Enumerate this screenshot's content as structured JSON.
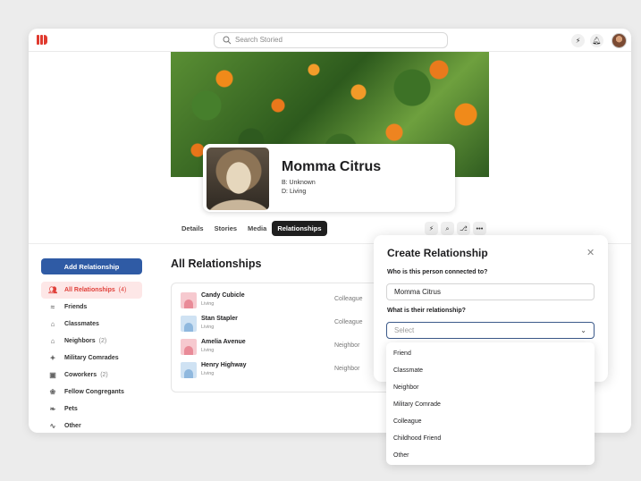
{
  "topbar": {
    "search_placeholder": "Search Storied",
    "icons": [
      "bolt-icon",
      "bell-icon"
    ]
  },
  "profile": {
    "name": "Momma Citrus",
    "birth": "B: Unknown",
    "death": "D: Living"
  },
  "tabs": [
    {
      "label": "Details"
    },
    {
      "label": "Stories"
    },
    {
      "label": "Media"
    },
    {
      "label": "Relationships",
      "active": true
    }
  ],
  "tab_tools": [
    "bolt-icon",
    "search-icon",
    "tree-icon",
    "more-icon"
  ],
  "sidebar": {
    "add_button": "Add Relationship",
    "items": [
      {
        "label": "All Relationships",
        "count": "(4)",
        "icon": "people-icon",
        "active": true
      },
      {
        "label": "Friends",
        "count": "",
        "icon": "handshake-icon"
      },
      {
        "label": "Classmates",
        "count": "",
        "icon": "school-icon"
      },
      {
        "label": "Neighbors",
        "count": "(2)",
        "icon": "house-icon"
      },
      {
        "label": "Military Comrades",
        "count": "",
        "icon": "medal-icon"
      },
      {
        "label": "Coworkers",
        "count": "(2)",
        "icon": "briefcase-icon"
      },
      {
        "label": "Fellow Congregants",
        "count": "",
        "icon": "praying-hands-icon"
      },
      {
        "label": "Pets",
        "count": "",
        "icon": "paw-icon"
      },
      {
        "label": "Other",
        "count": "",
        "icon": "group-icon"
      }
    ]
  },
  "main": {
    "title": "All Relationships",
    "rows": [
      {
        "name": "Candy Cubicle",
        "status": "Living",
        "type": "Colleague",
        "gender": "female"
      },
      {
        "name": "Stan Stapler",
        "status": "Living",
        "type": "Colleague",
        "gender": "male"
      },
      {
        "name": "Amelia Avenue",
        "status": "Living",
        "type": "Neighbor",
        "gender": "female"
      },
      {
        "name": "Henry Highway",
        "status": "Living",
        "type": "Neighbor",
        "gender": "male"
      }
    ]
  },
  "modal": {
    "title": "Create Relationship",
    "question1": "Who is this person connected to?",
    "person_value": "Momma Citrus",
    "question2": "What is their relationship?",
    "select_placeholder": "Select",
    "options": [
      "Friend",
      "Classmate",
      "Neighbor",
      "Military Comrade",
      "Colleague",
      "Childhood Friend",
      "Other"
    ]
  },
  "colors": {
    "accent_blue": "#2f5ba5",
    "brand_red": "#e03a2f",
    "active_pink": "#fde7e7",
    "female_placeholder": "#f6c9cf",
    "male_placeholder": "#cfe2f3"
  }
}
